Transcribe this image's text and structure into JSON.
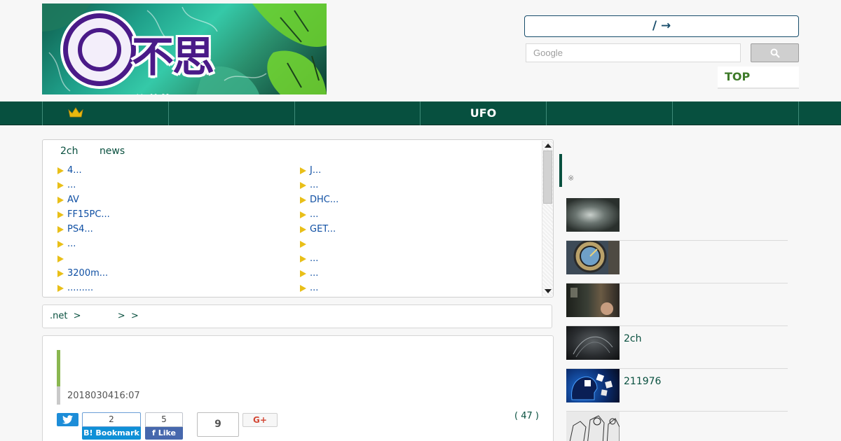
{
  "header": {
    "logo_text": "不思議.NET",
    "lang_box_text": "/ →",
    "search_placeholder": "Google",
    "top_link": "TOP",
    "colors": {
      "nav_bg": "#07503f",
      "accent_green": "#3e7a29",
      "logo_purple": "#4a1a88"
    }
  },
  "nav": {
    "items": [
      {
        "label": "",
        "icon": "crown-icon"
      },
      {
        "label": ""
      },
      {
        "label": ""
      },
      {
        "label": "UFO"
      },
      {
        "label": ""
      },
      {
        "label": ""
      }
    ]
  },
  "news": {
    "tabs": [
      "2ch",
      "news"
    ],
    "left": [
      "4...",
      " ...",
      "AV",
      "FF15PC...",
      "PS4...",
      "...",
      "",
      "3200m...",
      "........."
    ],
    "right": [
      "J...",
      "...",
      "DHC...",
      "...",
      "GET...",
      "",
      "...",
      "...",
      "..."
    ]
  },
  "breadcrumb": {
    "items": [
      ".net",
      ">",
      "",
      ">",
      ">"
    ]
  },
  "article": {
    "date": "2018030416:07",
    "share": {
      "hatena_count": "2",
      "hatena_label": "Bookmark",
      "fb_count": "5",
      "fb_label": "Like",
      "pocket_count": "9",
      "gplus_label": "G+"
    },
    "comment_count": "( 47 )"
  },
  "sidebar": {
    "note": "※",
    "items": [
      {
        "title": "",
        "thumb": "dark-room"
      },
      {
        "title": "",
        "thumb": "astronomical-clock"
      },
      {
        "title": "",
        "thumb": "dark-photo"
      },
      {
        "title": "2ch",
        "thumb": "dark-abstract"
      },
      {
        "title": "211976",
        "thumb": "puzzle-head"
      },
      {
        "title": "",
        "thumb": "manga"
      }
    ]
  }
}
